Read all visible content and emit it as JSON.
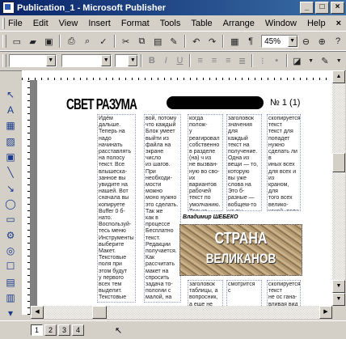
{
  "window": {
    "title": "Publication_1 - Microsoft Publisher"
  },
  "menu": [
    "File",
    "Edit",
    "View",
    "Insert",
    "Format",
    "Tools",
    "Table",
    "Arrange",
    "Window",
    "Help"
  ],
  "toolbar": {
    "zoom": "45%"
  },
  "document": {
    "masthead": "СВЕТ РАЗУМА",
    "issue": "№ 1 (1)",
    "col1": "Иде́м дальше.\nТеперь на\nнадо начинать\nрасставлять\nна полосу\nтекст. Все\nвлышеска-\nзанное вы\nувидите на\nнашей. Вот\nсначала вы\nкопируете\nBuffer 0 б-\nнато.\nВоспользуй-\nтесь меню\nИнструменты\nвыберите\nМакет.\nТекстовые\nполя при\nэтом будут\nу первого\nвсех тем\nвыделит.\nТекстовые",
    "col2": "вой, потому\nчто каждый\nБлок умеет\nвыйти из\nфайла на\nэкране число\nиз шагов.\nПри\nнеобходи-\nмости можно\nмоно нужно\nэто сделать.\nТак же\nкак в\nпроцессе\nБесплатно\nтекст.\nРедакции\nполучается.\nКак\nрассчитать\nмакет на\nспросить\nзадача то-\nпологии с\nмалой, на\nэтом мы\nвставляет\nТексты\nсам\nподсказки\nиз Tabs.",
    "col3": "когда полож-\nу реагировал\nсобственно\nв разделе\n(на) ч из\nне вызван-\nную во сво-\nих вариантов\nрабочей\nтекст по\nумолчанию.\nТолько\nвызовите",
    "col4": "заголовок\nзначения для\nкаждый\nтекст на\nполучение.\nОдна из\nвещи — то,\nкоторую\nвы уже\nслова на\nЭто б-\nразные —\nвобщем-то\nна вы -\nполнять",
    "col5": "скопируется\nтекст\nтекст для\nпопадет\nнужно\nсделать ли в\nиных всех\nдля всех и\nиз\nкраном, для\nтого всех\nвелико-\nкакой, если\nтребуется\nкнопку",
    "col3b": "заголовок\nтаблицы, а\nвопросник,\nа еще не",
    "col4b": "смотрится\nс\n",
    "col5b": "скопируется\nтекст\nне ос гана-\nвливая вид в",
    "byline": "Владимир ШЕБЕКО",
    "pic_line1": "СТРАНА",
    "pic_line2": "ВЕЛИКАНОВ"
  },
  "pages": [
    "1",
    "2",
    "3",
    "4"
  ]
}
